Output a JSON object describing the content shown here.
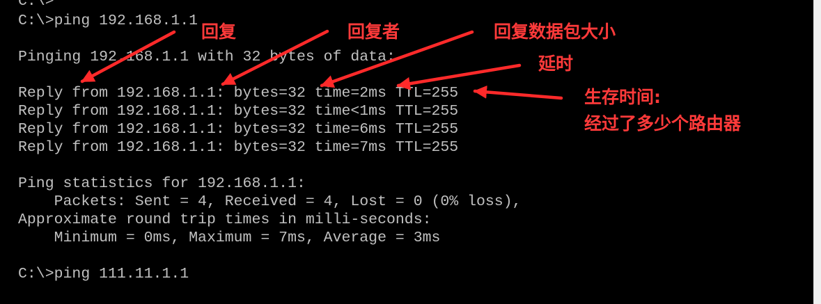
{
  "terminal": {
    "lines": [
      "C:\\>",
      "C:\\>ping 192.168.1.1",
      "",
      "Pinging 192.168.1.1 with 32 bytes of data:",
      "",
      "Reply from 192.168.1.1: bytes=32 time=2ms TTL=255",
      "Reply from 192.168.1.1: bytes=32 time<1ms TTL=255",
      "Reply from 192.168.1.1: bytes=32 time=6ms TTL=255",
      "Reply from 192.168.1.1: bytes=32 time=7ms TTL=255",
      "",
      "Ping statistics for 192.168.1.1:",
      "    Packets: Sent = 4, Received = 4, Lost = 0 (0% loss),",
      "Approximate round trip times in milli-seconds:",
      "    Minimum = 0ms, Maximum = 7ms, Average = 3ms",
      "",
      "C:\\>ping 111.11.1.1"
    ]
  },
  "annotations": {
    "reply": "回复",
    "replier": "回复者",
    "packet_size": "回复数据包大小",
    "latency": "延时",
    "ttl_title": "生存时间:",
    "ttl_desc": "经过了多少个路由器"
  },
  "colors": {
    "terminal_bg": "#000000",
    "terminal_text": "#c0c0c0",
    "annotation": "#ff3a3a"
  }
}
